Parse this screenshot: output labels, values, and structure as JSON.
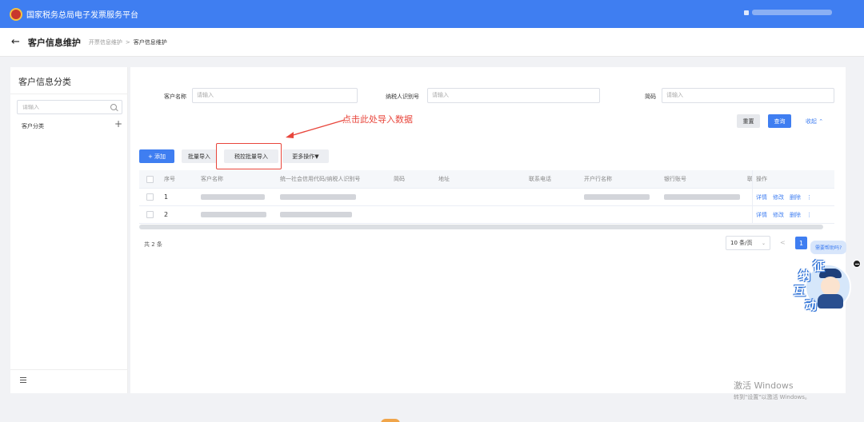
{
  "app": {
    "title": "国家税务总局电子发票服务平台"
  },
  "breadcrumb": {
    "back_icon": "←",
    "title": "客户信息维护",
    "items": [
      "开票信息维护",
      "客户信息维护"
    ],
    "separator": ">"
  },
  "sidebar": {
    "title": "客户信息分类",
    "search_placeholder": "请输入",
    "category": "客户分类",
    "add_icon": "+"
  },
  "filters": {
    "customer_name_label": "客户名称",
    "customer_name_placeholder": "请输入",
    "taxpayer_id_label": "纳税人识别号",
    "taxpayer_id_placeholder": "请输入",
    "short_code_label": "简码",
    "short_code_placeholder": "请输入",
    "reset_label": "重置",
    "query_label": "查询",
    "collapse_label": "收起 ⌃"
  },
  "toolbar": {
    "add_label": "+ 添加",
    "batch_import_label": "批量导入",
    "risk_import_label": "税控批量导入",
    "more_label": "更多操作▼"
  },
  "annotation": {
    "text": "点击此处导入数据",
    "color": "#e8463c"
  },
  "table": {
    "headers": [
      "序号",
      "客户名称",
      "统一社会信用代码/纳税人识别号",
      "简码",
      "地址",
      "联系电话",
      "开户行名称",
      "银行账号",
      "联",
      "操作"
    ],
    "rows": [
      {
        "index": "1",
        "actions": [
          "详情",
          "修改",
          "删除",
          "⋮"
        ]
      },
      {
        "index": "2",
        "actions": [
          "详情",
          "修改",
          "删除",
          "⋮"
        ]
      }
    ]
  },
  "pagination": {
    "total": "共 2 条",
    "page_size": "10 条/页",
    "chevron": "⌄",
    "prev": "<",
    "current_page": "1"
  },
  "help": {
    "bubble": "需要帮助吗?",
    "chars": [
      "征",
      "纳",
      "互",
      "动"
    ]
  },
  "watermark": {
    "line1": "激活 Windows",
    "line2": "转到\"设置\"以激活 Windows。"
  },
  "colors": {
    "primary": "#3f7ef1",
    "annotation_red": "#e8463c"
  }
}
